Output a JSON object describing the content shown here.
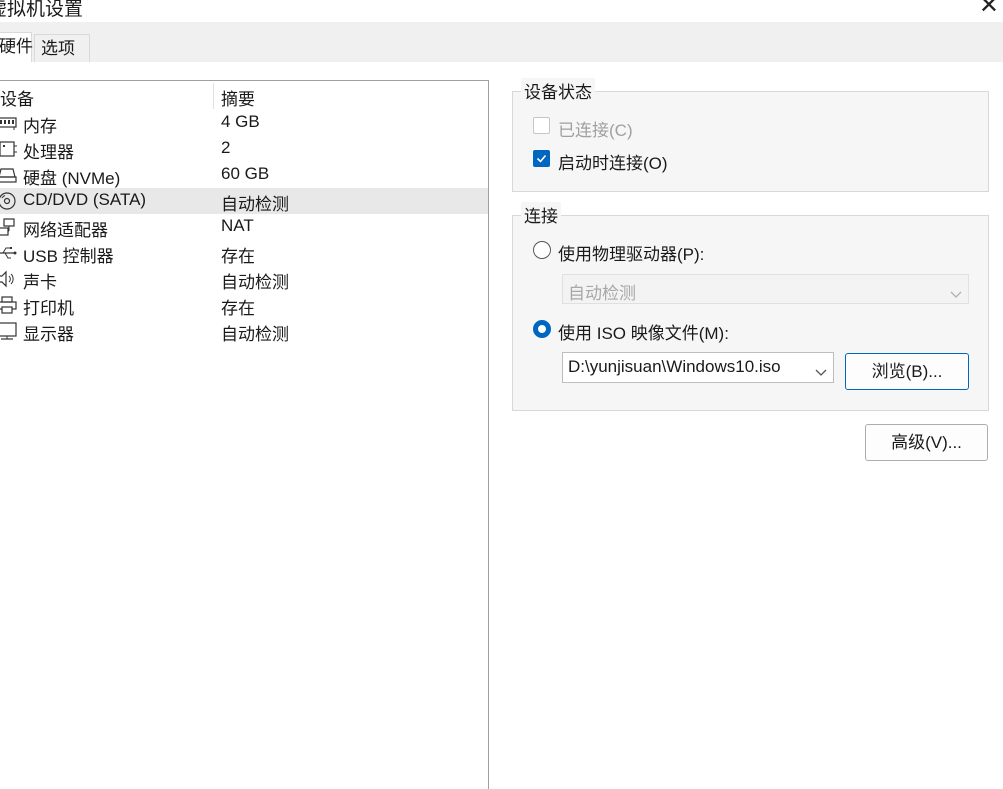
{
  "window": {
    "title": "虚拟机设置",
    "close_glyph": "✕"
  },
  "tabs": [
    {
      "label": "硬件",
      "active": true
    },
    {
      "label": "选项",
      "active": false
    }
  ],
  "device_list": {
    "columns": {
      "device": "设备",
      "summary": "摘要"
    },
    "rows": [
      {
        "icon": "memory-icon",
        "name": "内存",
        "summary": "4 GB"
      },
      {
        "icon": "cpu-icon",
        "name": "处理器",
        "summary": "2"
      },
      {
        "icon": "harddisk-icon",
        "name": "硬盘 (NVMe)",
        "summary": "60 GB"
      },
      {
        "icon": "cd-dvd-icon",
        "name": "CD/DVD (SATA)",
        "summary": "自动检测",
        "selected": true
      },
      {
        "icon": "network-icon",
        "name": "网络适配器",
        "summary": "NAT"
      },
      {
        "icon": "usb-icon",
        "name": "USB 控制器",
        "summary": "存在"
      },
      {
        "icon": "speaker-icon",
        "name": "声卡",
        "summary": "自动检测"
      },
      {
        "icon": "printer-icon",
        "name": "打印机",
        "summary": "存在"
      },
      {
        "icon": "monitor-icon",
        "name": "显示器",
        "summary": "自动检测"
      }
    ]
  },
  "device_status": {
    "title": "设备状态",
    "connected": {
      "label": "已连接(C)",
      "checked": false,
      "enabled": false
    },
    "connect_at_power_on": {
      "label": "启动时连接(O)",
      "checked": true,
      "enabled": true
    }
  },
  "connection": {
    "title": "连接",
    "physical_drive": {
      "label": "使用物理驱动器(P):",
      "selected": false
    },
    "physical_drive_select": {
      "value": "自动检测",
      "enabled": false
    },
    "iso_image": {
      "label": "使用 ISO 映像文件(M):",
      "selected": true
    },
    "iso_path": {
      "value": "D:\\yunjisuan\\Windows10.iso"
    },
    "browse_button": "浏览(B)..."
  },
  "advanced_button": "高级(V)...",
  "colors": {
    "accent": "#0067c0",
    "selection": "#e8e8e8"
  }
}
